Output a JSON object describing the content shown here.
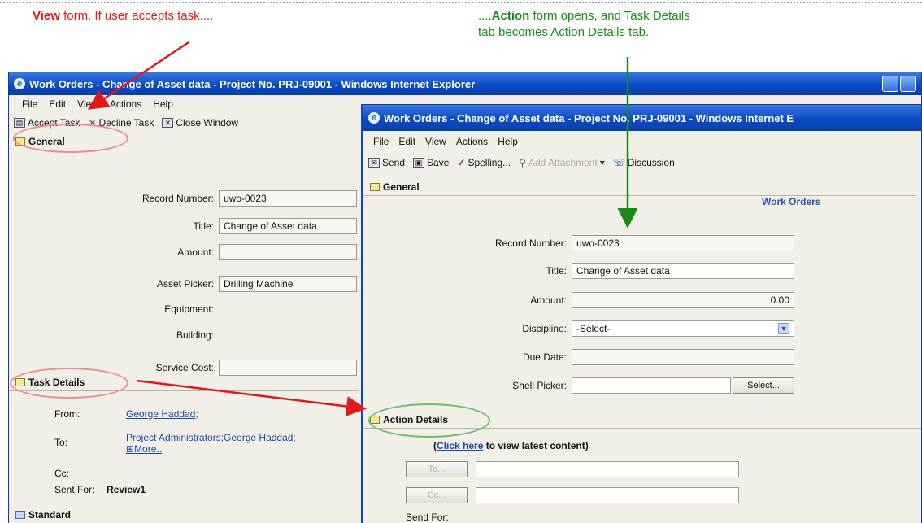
{
  "captions": {
    "left_bold": "View",
    "left_rest": " form. If user accepts task....",
    "right_prefix": "....",
    "right_bold": "Action",
    "right_rest": " form opens, and Task Details",
    "right_line2": "tab becomes Action Details tab."
  },
  "view_window": {
    "title": "Work Orders - Change of Asset data - Project No. PRJ-09001 - Windows Internet Explorer",
    "menu": [
      "File",
      "Edit",
      "View",
      "Actions",
      "Help"
    ],
    "toolbar": {
      "accept": "Accept Task",
      "decline": "Decline Task",
      "close": "Close Window"
    },
    "general_tab": "General",
    "fields": {
      "record_number_label": "Record Number:",
      "record_number_value": "uwo-0023",
      "title_label": "Title:",
      "title_value": "Change of Asset data",
      "amount_label": "Amount:",
      "asset_picker_label": "Asset Picker:",
      "asset_picker_value": "Drilling Machine",
      "equipment_label": "Equipment:",
      "building_label": "Building:",
      "service_cost_label": "Service Cost:"
    },
    "task_details_tab": "Task Details",
    "task": {
      "from_label": "From:",
      "from_value": "George Haddad;",
      "to_label": "To:",
      "to_value": "Project Administrators;George Haddad;",
      "more": "More..",
      "cc_label": "Cc:",
      "sent_for_label": "Sent For:",
      "sent_for_value": "Review1"
    },
    "standard_tab": "Standard"
  },
  "action_window": {
    "title": "Work Orders - Change of Asset data - Project No. PRJ-09001 - Windows Internet E",
    "menu": [
      "File",
      "Edit",
      "View",
      "Actions",
      "Help"
    ],
    "toolbar": {
      "send": "Send",
      "save": "Save",
      "spelling": "Spelling...",
      "add_attachment": "Add Attachment",
      "discussion": "Discussion"
    },
    "module_name": "Work Orders",
    "general_tab": "General",
    "fields": {
      "record_number_label": "Record Number:",
      "record_number_value": "uwo-0023",
      "title_label": "Title:",
      "title_value": "Change of Asset data",
      "amount_label": "Amount:",
      "amount_value": "0.00",
      "discipline_label": "Discipline:",
      "discipline_value": "-Select-",
      "due_date_label": "Due Date:",
      "shell_picker_label": "Shell Picker:",
      "select_button": "Select..."
    },
    "action_details_tab": "Action Details",
    "click_here_link": "Click here",
    "click_here_rest": " to view latest content)",
    "click_here_open": "(",
    "to_button": "To...",
    "cc_button": "Cc...",
    "send_for_label": "Send For:"
  },
  "colors": {
    "red_annotation": "#e01818",
    "green_annotation": "#1a8c1a",
    "title_blue": "#0a4bc4"
  }
}
